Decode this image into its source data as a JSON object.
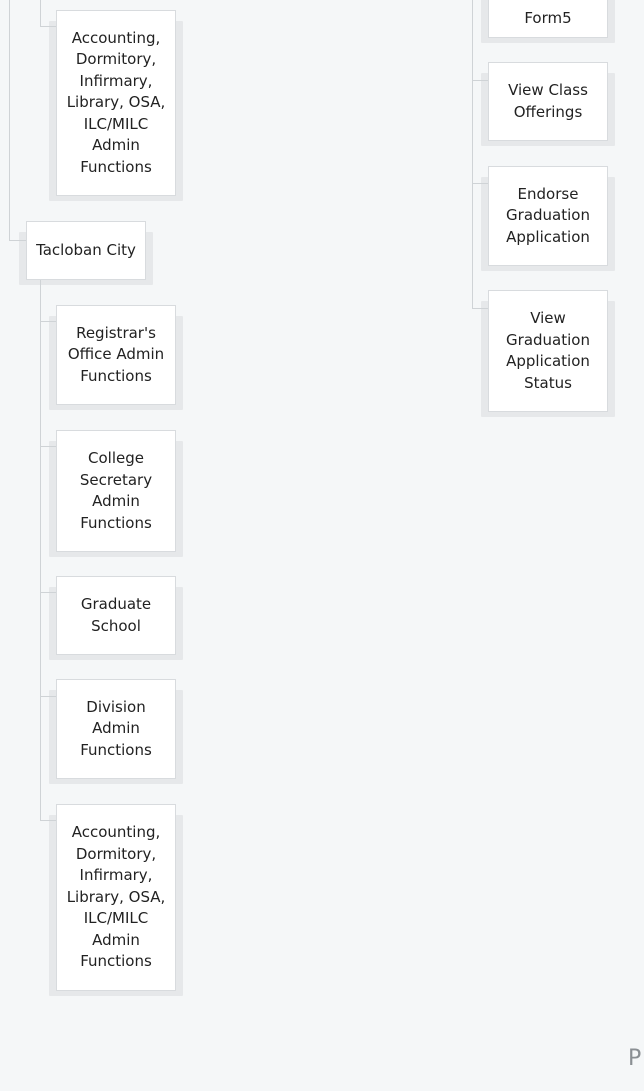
{
  "tree_left": {
    "top_group": {
      "nodes": {
        "accounting_etc": "Accounting, Dormitory, Infirmary, Library, OSA, ILC/MILC Admin Functions"
      }
    },
    "campus_tacloban": {
      "label": "Tacloban City",
      "children": [
        "Registrar's Office Admin Functions",
        "College Secretary Admin Functions",
        "Graduate School",
        "Division Admin Functions",
        "Accounting, Dormitory, Infirmary, Library, OSA, ILC/MILC Admin Functions"
      ]
    }
  },
  "tree_right": {
    "nodes": [
      "Form5",
      "View Class Offerings",
      "Endorse Graduation Application",
      "View Graduation Application Status"
    ]
  },
  "corner_label": "P"
}
